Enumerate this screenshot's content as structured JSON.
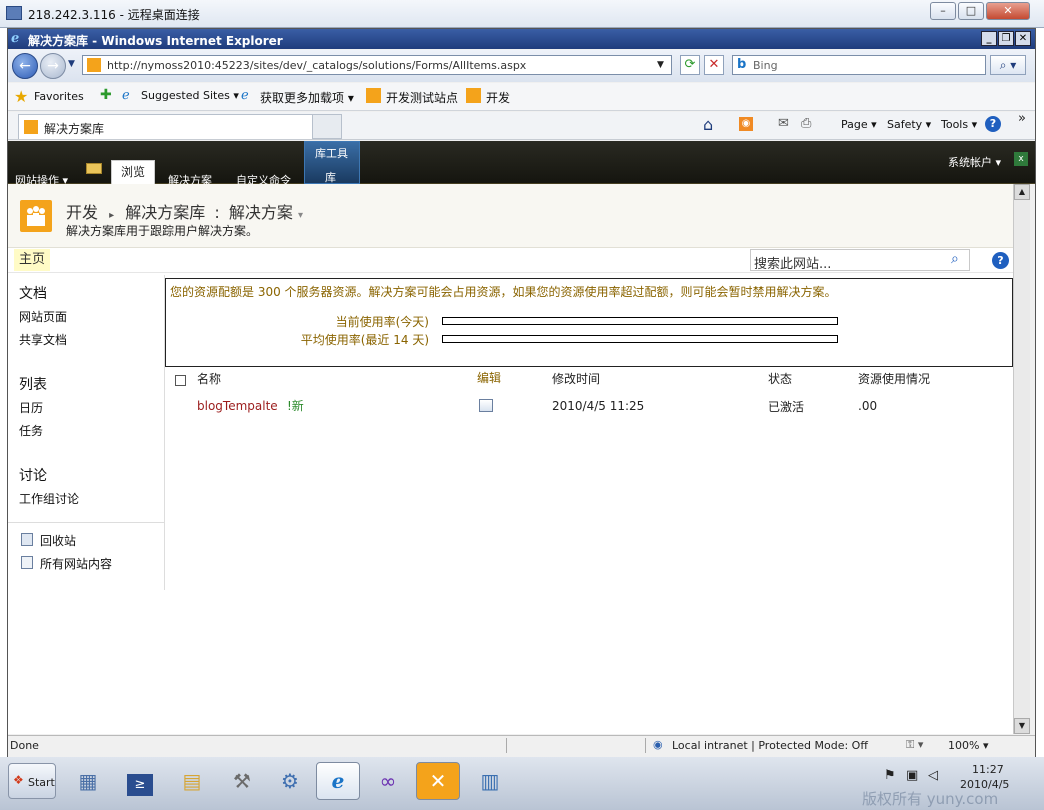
{
  "rdp": {
    "title": "218.242.3.116 - 远程桌面连接"
  },
  "ie": {
    "title": "解决方案库 - Windows Internet Explorer",
    "address_url": "http://nymoss2010:45223/sites/dev/_catalogs/solutions/Forms/AllItems.aspx",
    "search_placeholder": "Bing",
    "favorites": {
      "label": "Favorites",
      "items": [
        "Suggested Sites ▾",
        "获取更多加载项 ▾",
        "开发测试站点",
        "开发"
      ]
    },
    "tab_title": "解决方案库",
    "commands": {
      "page": "Page ▾",
      "safety": "Safety ▾",
      "tools": "Tools ▾"
    }
  },
  "ribbon": {
    "site_actions": "网站操作 ▾",
    "tabs": [
      "浏览",
      "解决方案",
      "自定义命令"
    ],
    "library_tools_group": "库工具",
    "library_tab": "库",
    "user": "系统帐户 ▾"
  },
  "page": {
    "breadcrumb": [
      "开发",
      "解决方案库",
      "解决方案"
    ],
    "description": "解决方案库用于跟踪用户解决方案。",
    "home_tab": "主页",
    "search_placeholder": "搜索此网站..."
  },
  "quicklaunch": {
    "sections": [
      {
        "heading": "文档",
        "items": [
          "网站页面",
          "共享文档"
        ]
      },
      {
        "heading": "列表",
        "items": [
          "日历",
          "任务"
        ]
      },
      {
        "heading": "讨论",
        "items": [
          "工作组讨论"
        ]
      }
    ],
    "recycle": "回收站",
    "all_content": "所有网站内容"
  },
  "quota": {
    "message": "您的资源配额是 300 个服务器资源。解决方案可能会占用资源，如果您的资源使用率超过配额，则可能会暂时禁用解决方案。",
    "today_label": "当前使用率(今天)",
    "average_label": "平均使用率(最近 14 天)",
    "today_value": 0,
    "average_value": 0
  },
  "table": {
    "headers": {
      "name": "名称",
      "edit": "编辑",
      "modified": "修改时间",
      "status": "状态",
      "usage": "资源使用情况"
    },
    "rows": [
      {
        "name": "blogTempalte",
        "new_badge": "!新",
        "modified": "2010/4/5 11:25",
        "status": "已激活",
        "usage": ".00"
      }
    ]
  },
  "statusbar": {
    "left": "Done",
    "zone": "Local intranet | Protected Mode: Off",
    "zoom": "100% ▾"
  },
  "taskbar": {
    "start": "Start",
    "time": "11:27",
    "date": "2010/4/5",
    "watermark": "版权所有 yuny.com"
  },
  "colors": {
    "ribbon_bg": "#1c1c16",
    "quota_text": "#8a6400",
    "link_red": "#9b1c1c",
    "new_green": "#2b8a2b"
  }
}
